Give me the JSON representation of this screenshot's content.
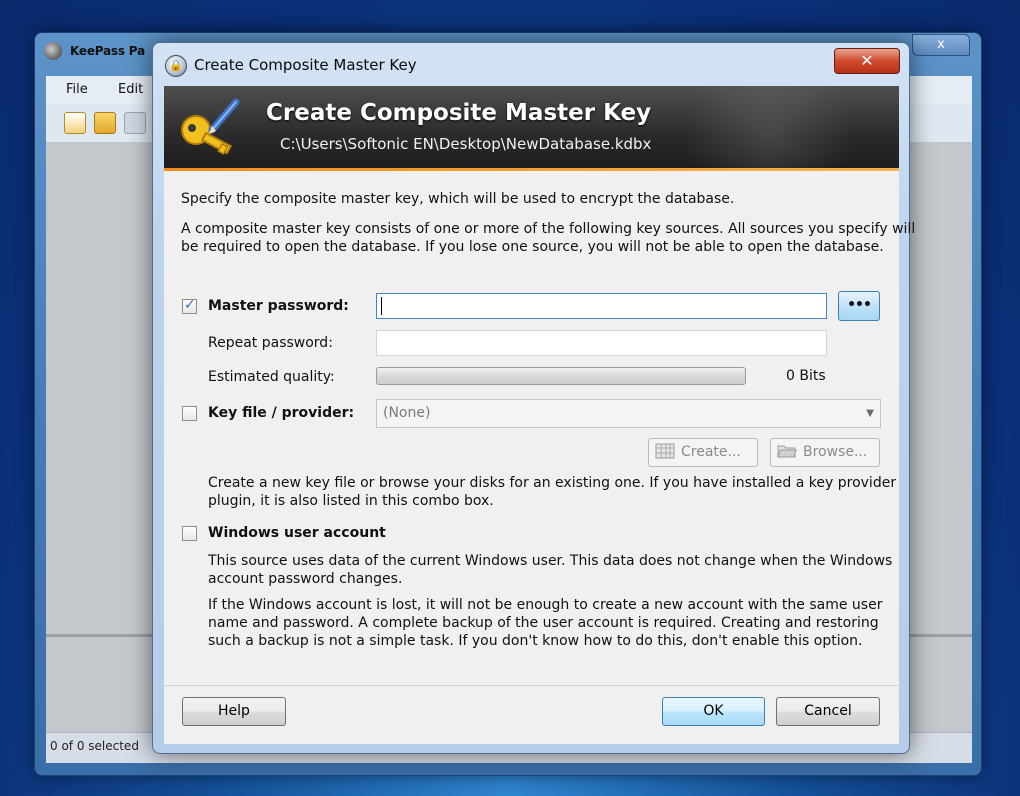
{
  "background_window": {
    "title": "KeePass Pa",
    "close_glyph": "x",
    "menu": [
      "File",
      "Edit"
    ],
    "status": "0 of 0 selected"
  },
  "dialog": {
    "title": "Create Composite Master Key",
    "close_glyph": "✕"
  },
  "banner": {
    "title": "Create Composite Master Key",
    "path": "C:\\Users\\Softonic EN\\Desktop\\NewDatabase.kdbx"
  },
  "intro": {
    "line1": "Specify the composite master key, which will be used to encrypt the database.",
    "line2a": "A composite master key consists of one or more of the following key sources. All sources you specify will",
    "line2b": "be required to open the database.  If you lose one source, you will not be able to open the database."
  },
  "master_password": {
    "label": "Master password:",
    "checked": true,
    "value": "",
    "dots_label": "•••"
  },
  "repeat_password": {
    "label": "Repeat password:",
    "value": ""
  },
  "quality": {
    "label": "Estimated quality:",
    "value_text": "0 Bits",
    "fraction": 0
  },
  "key_file": {
    "label": "Key file / provider:",
    "checked": false,
    "selected": "(None)",
    "create_label": "Create...",
    "browse_label": "Browse...",
    "help_a": "Create a new key file or browse your disks for an existing one. If you have installed a key provider",
    "help_b": "plugin, it is also listed in this combo box."
  },
  "windows_account": {
    "label": "Windows user account",
    "checked": false,
    "desc1a": "This source uses data of the current Windows user. This data does not change when the Windows",
    "desc1b": "account password changes.",
    "desc2a": "If the Windows account is lost, it will not be enough to create a new account with the same user",
    "desc2b": "name and password. A complete backup of the user account is required. Creating and restoring",
    "desc2c": "such a backup is not a simple task. If you don't know how to do this, don't enable this option."
  },
  "buttons": {
    "help": "Help",
    "ok": "OK",
    "cancel": "Cancel"
  },
  "colors": {
    "banner_accent": "#f08a1c",
    "close_red": "#cf4a2d",
    "default_button": "#3c7fb1"
  }
}
